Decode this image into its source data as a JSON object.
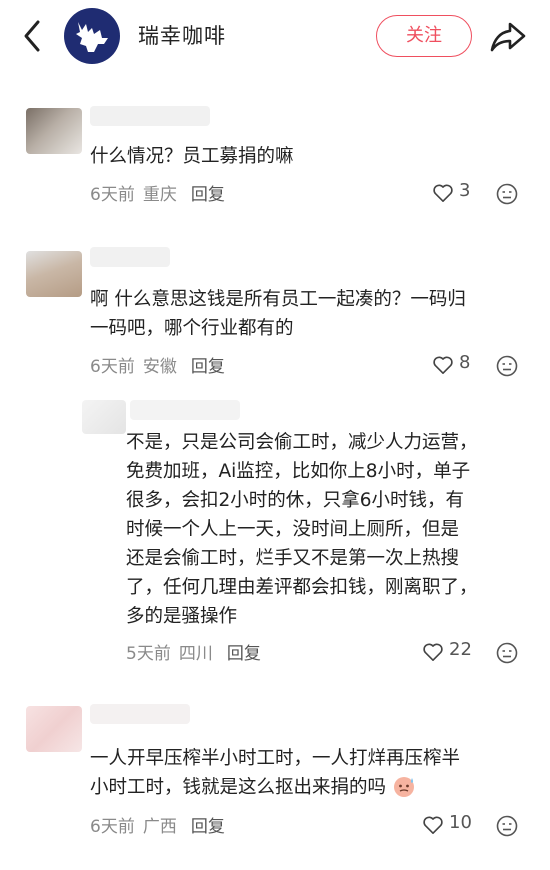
{
  "header": {
    "brand_name": "瑞幸咖啡",
    "follow_label": "关注"
  },
  "comments": [
    {
      "text": "什么情况？员工募捐的嘛",
      "time": "6天前",
      "location": "重庆",
      "reply_label": "回复",
      "likes": "3"
    },
    {
      "text_line1": "啊 什么意思这钱是所有员工一起凑的？一码归",
      "text_line2": "一码吧，哪个行业都有的",
      "time": "6天前",
      "location": "安徽",
      "reply_label": "回复",
      "likes": "8"
    },
    {
      "lines": [
        "不是，只是公司会偷工时，减少人力运营，",
        "免费加班，Ai监控，比如你上8小时，单子",
        "很多，会扣2小时的休，只拿6小时钱，有",
        "时候一个人上一天，没时间上厕所，但是",
        "还是会偷工时，烂手又不是第一次上热搜",
        "了，任何几理由差评都会扣钱，刚离职了，",
        "多的是骚操作"
      ],
      "time": "5天前",
      "location": "四川",
      "reply_label": "回复",
      "likes": "22"
    },
    {
      "text_line1": "一人开早压榨半小时工时，一人打烊再压榨半",
      "text_line2": "小时工时，钱就是这么抠出来捐的吗",
      "time": "6天前",
      "location": "广西",
      "reply_label": "回复",
      "likes": "10"
    }
  ],
  "icons": {
    "back": "back-arrow-icon",
    "share": "share-icon",
    "like": "heart-icon",
    "emoji": "emoji-face-icon",
    "sweat": "sweat-emoji-icon"
  },
  "colors": {
    "accent": "#ef4f5f",
    "brand_blue": "#1f2c72",
    "meta_gray": "#8a8a8a"
  }
}
